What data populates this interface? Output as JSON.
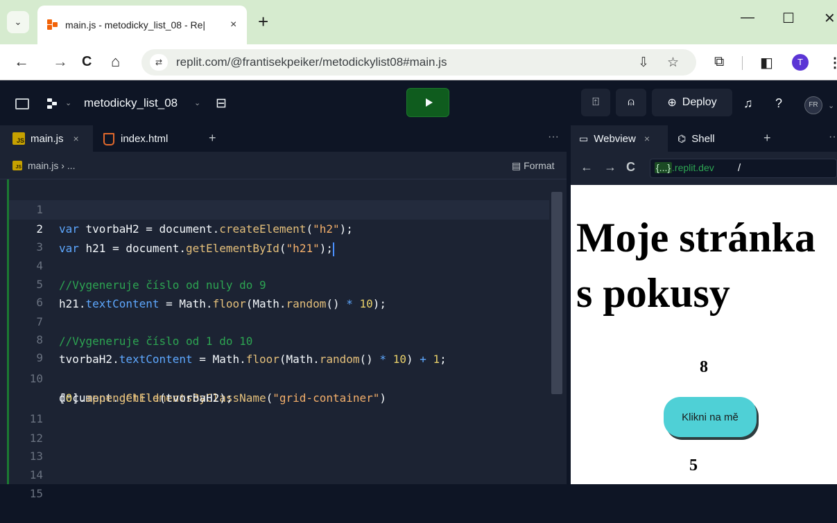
{
  "browser": {
    "tab_title": "main.js - metodicky_list_08 - Re|",
    "tab_close": "×",
    "new_tab": "+",
    "tab_menu": "⌄",
    "window_controls": {
      "minimize": "—",
      "maximize": "☐",
      "close": "✕"
    },
    "nav": {
      "back": "←",
      "forward": "→",
      "reload": "C",
      "home": "⌂"
    },
    "site_info": "⇄",
    "url": "replit.com/@frantisekpeiker/metodickylist08#main.js",
    "install_icon": "⇩",
    "bookmark_icon": "☆",
    "extensions_icon": "⧉",
    "sidepanel_icon": "◧",
    "profile_letter": "T",
    "menu_icon": "⋮"
  },
  "replit": {
    "repl_name": "metodicky_list_08",
    "chevron": "⌄",
    "deploy_label": "Deploy",
    "avatar_initials": "FR",
    "icons": {
      "devices": "⍐",
      "invite": "⍝",
      "deploy": "⊕",
      "bell": "♫",
      "help": "?"
    }
  },
  "editor": {
    "tabs": [
      {
        "label": "main.js",
        "close": "×",
        "active": true
      },
      {
        "label": "index.html",
        "active": false
      }
    ],
    "add_tab": "+",
    "more": "···",
    "breadcrumb": "main.js  ›  ...",
    "format_label": "Format",
    "lines": [
      {
        "n": "1"
      },
      {
        "n": "2"
      },
      {
        "n": "3"
      },
      {
        "n": "4"
      },
      {
        "n": "5"
      },
      {
        "n": "6"
      },
      {
        "n": "7"
      },
      {
        "n": "8"
      },
      {
        "n": "9"
      },
      {
        "n": "10"
      },
      {
        "n": "11"
      },
      {
        "n": "12"
      },
      {
        "n": "13"
      },
      {
        "n": "14"
      },
      {
        "n": "15"
      }
    ],
    "code": {
      "l1": {
        "kw": "var",
        "name": " tvorbaH2 = ",
        "obj": "document.",
        "fn": "createElement",
        "p1": "(",
        "str": "\"h2\"",
        "p2": ");"
      },
      "l2": {
        "kw": "var",
        "name": " h21 = ",
        "obj": "document.",
        "fn": "getElementById",
        "p1": "(",
        "str": "\"h21\"",
        "p2": ");"
      },
      "l4": "//Vygeneruje číslo od nuly do 9",
      "l5": {
        "a": "h21.",
        "prop": "textContent",
        "b": " = Math.",
        "fn": "floor",
        "c": "(Math.",
        "fn2": "random",
        "d": "() ",
        "op": "*",
        "e": " ",
        "num": "10",
        "f": ");"
      },
      "l7": "//Vygeneruje číslo od 1 do 10",
      "l8": {
        "a": "tvorbaH2.",
        "prop": "textContent",
        "b": " = Math.",
        "fn": "floor",
        "c": "(Math.",
        "fn2": "random",
        "d": "() ",
        "op": "*",
        "e": " ",
        "num": "10",
        "f": ") ",
        "op2": "+",
        "g": " ",
        "num2": "1",
        "h": ";"
      },
      "l10": {
        "a": "document.",
        "fn": "getElementsByClassName",
        "p1": "(",
        "str": "\"grid-container\"",
        "p2": ")"
      },
      "l10b": {
        "a": "[",
        "num": "0",
        "b": "].",
        "fn": "appendChild",
        "c": "(tvorbaH2);"
      }
    }
  },
  "webview": {
    "tabs": [
      {
        "label": "Webview",
        "close": "×",
        "active": true
      },
      {
        "label": "Shell",
        "active": false
      }
    ],
    "add_tab": "+",
    "more": "··",
    "nav": {
      "back": "←",
      "forward": "→",
      "reload": "C"
    },
    "url_badge": "{...}",
    "url_host": ".replit.dev",
    "url_path": "/",
    "page": {
      "heading": "Moje stránka s pokusy",
      "number_1": "8",
      "button_label": "Klikni na mě",
      "number_2": "5"
    }
  }
}
